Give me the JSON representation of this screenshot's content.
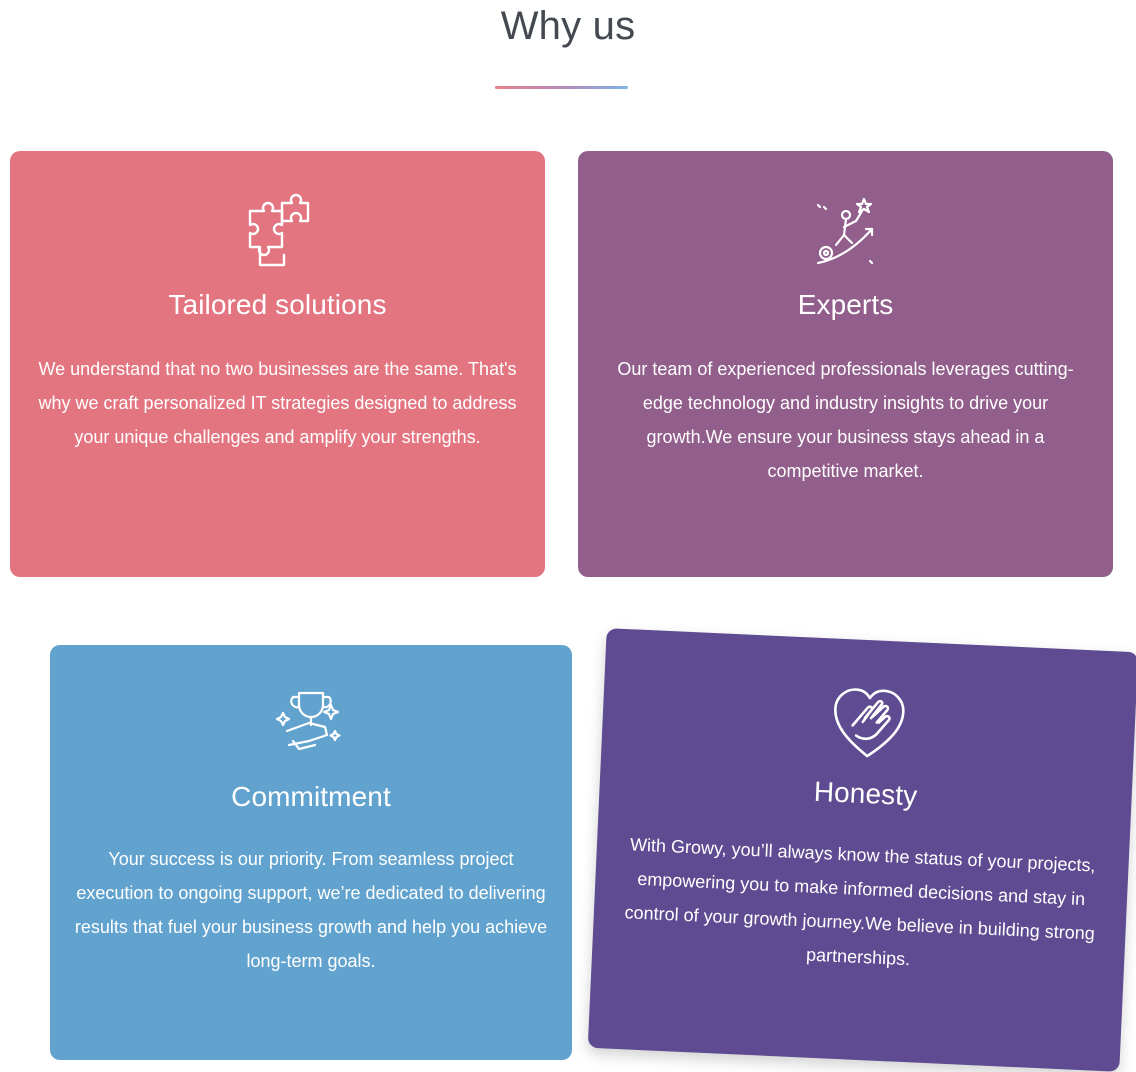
{
  "section": {
    "title": "Why us"
  },
  "colors": {
    "tailored": "#e37581",
    "experts": "#925e8b",
    "commitment": "#61a3ce",
    "honesty": "#5e4b91",
    "underline_gradient": [
      "#e7838c",
      "#b689b8",
      "#7fb4e3"
    ]
  },
  "cards": [
    {
      "icon": "puzzle-icon",
      "title": "Tailored solutions",
      "text": "We understand that no two businesses are the same. That's why we craft personalized IT strategies designed to address your unique challenges and amplify your strengths."
    },
    {
      "icon": "growth-climber-icon",
      "title": "Experts",
      "text": "Our team of experienced professionals leverages cutting-edge technology and industry insights to drive your growth.We ensure your business stays ahead in a competitive market."
    },
    {
      "icon": "trophy-icon",
      "title": "Commitment",
      "text": "Your success is our priority. From seamless project execution to ongoing support, we’re dedicated to delivering results that fuel your business growth and help you achieve long-term goals."
    },
    {
      "icon": "heart-hand-icon",
      "title": "Honesty",
      "text": "With Growy, you’ll always know the status of your projects, empowering you to make informed decisions and stay in control of your growth journey.We believe in building strong partnerships."
    }
  ]
}
